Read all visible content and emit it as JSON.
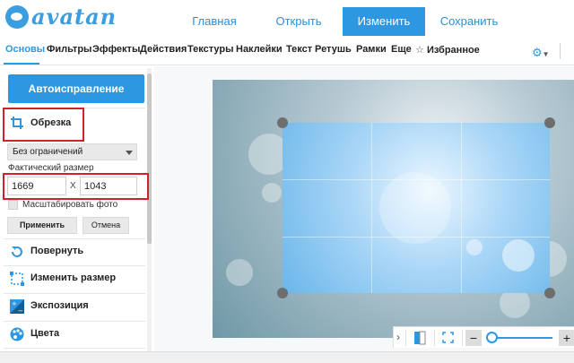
{
  "app": {
    "logo_text": "avatan",
    "logo_icon": "whale-logo-icon"
  },
  "topnav": [
    {
      "label": "Главная",
      "active": false
    },
    {
      "label": "Открыть",
      "active": false
    },
    {
      "label": "Изменить",
      "active": true
    },
    {
      "label": "Сохранить",
      "active": false
    }
  ],
  "tabs": [
    {
      "label": "Основы",
      "active": true
    },
    {
      "label": "Фильтры"
    },
    {
      "label": "Эффекты"
    },
    {
      "label": "Действия"
    },
    {
      "label": "Текстуры"
    },
    {
      "label": "Наклейки"
    },
    {
      "label": "Текст"
    },
    {
      "label": "Ретушь"
    },
    {
      "label": "Рамки"
    },
    {
      "label": "Еще"
    },
    {
      "label": "Избранное",
      "icon": "star-icon"
    }
  ],
  "panel": {
    "auto_button": "Автоисправление",
    "crop": {
      "label": "Обрезка",
      "icon": "crop-icon",
      "ratio_select": "Без ограничений",
      "fact_size_label": "Фактический размер",
      "width": "1669",
      "height": "1043",
      "x_label": "X",
      "scale_label": "Масштабировать фото",
      "scale_checked": false,
      "apply": "Применить",
      "cancel": "Отмена"
    },
    "tools": [
      {
        "label": "Повернуть",
        "icon": "rotate-icon"
      },
      {
        "label": "Изменить размер",
        "icon": "resize-icon"
      },
      {
        "label": "Экспозиция",
        "icon": "exposure-icon"
      },
      {
        "label": "Цвета",
        "icon": "palette-icon"
      }
    ]
  },
  "colors": {
    "accent": "#2d97e2",
    "highlight": "#d0212d"
  },
  "zoombar": {
    "collapse_icon": "chevron-right-icon",
    "compare_icon": "compare-icon",
    "fit_icon": "fullscreen-icon",
    "minus": "−",
    "plus": "+",
    "zoom_level": 0
  }
}
